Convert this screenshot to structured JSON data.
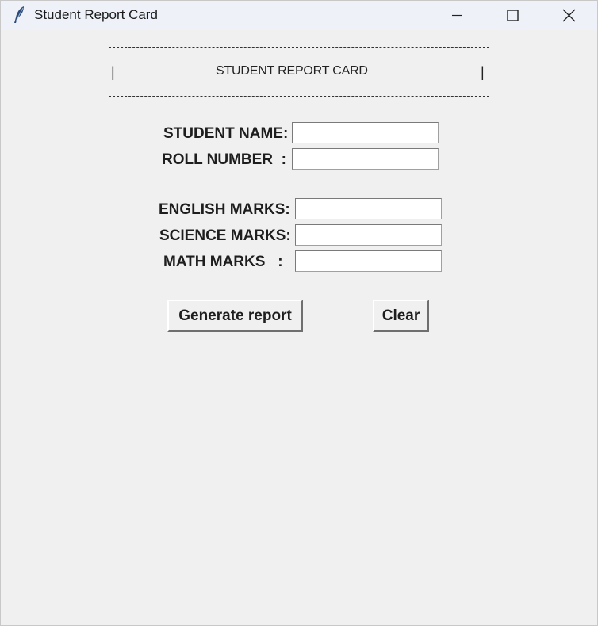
{
  "window": {
    "title": "Student Report Card"
  },
  "header": {
    "left_pipe": "|",
    "text": "STUDENT REPORT CARD",
    "right_pipe": "|"
  },
  "form": {
    "student_name_label": "STUDENT NAME:",
    "student_name_value": "",
    "roll_number_label": "ROLL NUMBER  :",
    "roll_number_value": "",
    "english_label": "ENGLISH MARKS:",
    "english_value": "",
    "science_label": "SCIENCE MARKS:",
    "science_value": "",
    "math_label": "MATH MARKS   :",
    "math_value": ""
  },
  "buttons": {
    "generate_label": "Generate report",
    "clear_label": "Clear"
  },
  "icons": {
    "app": "feather-icon",
    "minimize": "minimize-icon",
    "maximize": "maximize-icon",
    "close": "close-icon"
  }
}
